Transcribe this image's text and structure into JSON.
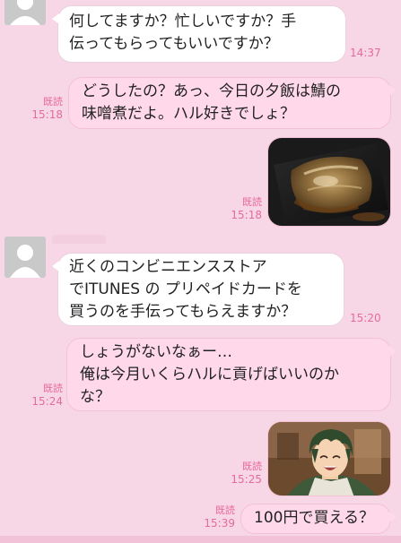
{
  "messages": [
    {
      "id": "m1",
      "from": "friend",
      "lines": [
        "何してますか？忙しいですか？手",
        "伝ってもらってもいいですか？"
      ],
      "time": "14:37"
    },
    {
      "id": "m2",
      "from": "me",
      "lines": [
        "どうしたの？あっ、今日の夕飯は鯖の",
        "味噌煮だよ。ハル好きでしょ？"
      ],
      "read": "既読",
      "time": "15:18"
    },
    {
      "id": "m3",
      "from": "me",
      "image": "mackerel-miso-photo",
      "read": "既読",
      "time": "15:18"
    },
    {
      "id": "m4",
      "from": "friend",
      "lines": [
        "近くのコンビニエンスストア",
        "でITUNES の プリペイドカードを",
        "買うのを手伝ってもらえますか？"
      ],
      "time": "15:20"
    },
    {
      "id": "m5",
      "from": "me",
      "lines": [
        "しょうがないなぁー…",
        "俺は今月いくらハルに貢げばいいのか",
        "な？"
      ],
      "read": "既読",
      "time": "15:24"
    },
    {
      "id": "m6",
      "from": "me",
      "image": "anime-character-photo",
      "read": "既読",
      "time": "15:25"
    },
    {
      "id": "m7",
      "from": "me",
      "lines": [
        "100円で買える？"
      ],
      "read": "既読",
      "time": "15:39"
    }
  ],
  "colors": {
    "background": "#f7d7e6",
    "incoming_bubble": "#ffffff",
    "outgoing_bubble": "#ffd9ea",
    "meta_text": "#e46b9b"
  }
}
